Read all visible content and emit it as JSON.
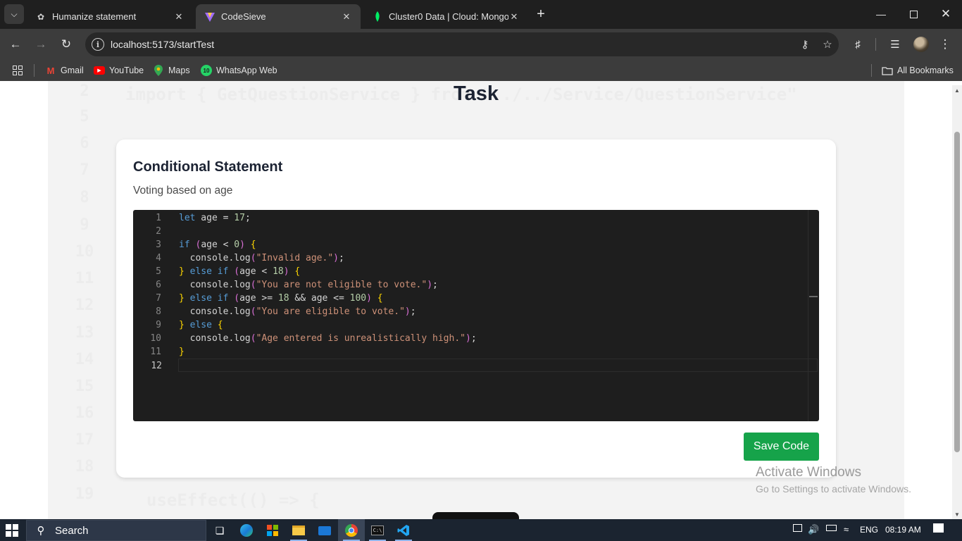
{
  "browser": {
    "tabs": [
      {
        "title": "Humanize statement",
        "favicon": "openai-icon",
        "active": false
      },
      {
        "title": "CodeSieve",
        "favicon": "vite-icon",
        "active": true
      },
      {
        "title": "Cluster0 Data | Cloud: MongoDB",
        "favicon": "mongodb-leaf-icon",
        "active": false
      }
    ],
    "url": "localhost:5173/startTest",
    "bookmarks": [
      {
        "label": "Gmail",
        "icon": "gmail-icon"
      },
      {
        "label": "YouTube",
        "icon": "youtube-icon"
      },
      {
        "label": "Maps",
        "icon": "maps-icon"
      },
      {
        "label": "WhatsApp Web",
        "icon": "whatsapp-icon",
        "badge": "10"
      }
    ],
    "all_bookmarks": "All Bookmarks"
  },
  "page": {
    "title": "Task",
    "card": {
      "title": "Conditional Statement",
      "description": "Voting based on age"
    },
    "save_button": "Save Code",
    "background_code": {
      "line2": "import { GetQuestionService } from \"../../Service/QuestionService\"",
      "line19": "useEffect(() => {",
      "line_numbers": [
        "2",
        "5",
        "6",
        "7",
        "8",
        "9",
        "10",
        "11",
        "12",
        "13",
        "14",
        "15",
        "16",
        "17",
        "18",
        "19"
      ]
    }
  },
  "editor": {
    "current_line": 12,
    "lines": [
      {
        "n": "1"
      },
      {
        "n": "2"
      },
      {
        "n": "3"
      },
      {
        "n": "4"
      },
      {
        "n": "5"
      },
      {
        "n": "6"
      },
      {
        "n": "7"
      },
      {
        "n": "8"
      },
      {
        "n": "9"
      },
      {
        "n": "10"
      },
      {
        "n": "11"
      },
      {
        "n": "12"
      }
    ],
    "code": [
      "let age = 17;",
      "",
      "if (age < 0) {",
      "  console.log(\"Invalid age.\");",
      "} else if (age < 18) {",
      "  console.log(\"You are not eligible to vote.\");",
      "} else if (age >= 18 && age <= 100) {",
      "  console.log(\"You are eligible to vote.\");",
      "} else {",
      "  console.log(\"Age entered is unrealistically high.\");",
      "}",
      ""
    ]
  },
  "watermark": {
    "title": "Activate Windows",
    "subtitle": "Go to Settings to activate Windows."
  },
  "taskbar": {
    "search_label": "Search",
    "language": "ENG",
    "time": "08:19 AM"
  },
  "colors": {
    "save_button": "#16a34a",
    "editor_bg": "#1e1e1e",
    "keyword": "#569cd6",
    "string": "#ce9178",
    "number": "#b5cea8"
  }
}
